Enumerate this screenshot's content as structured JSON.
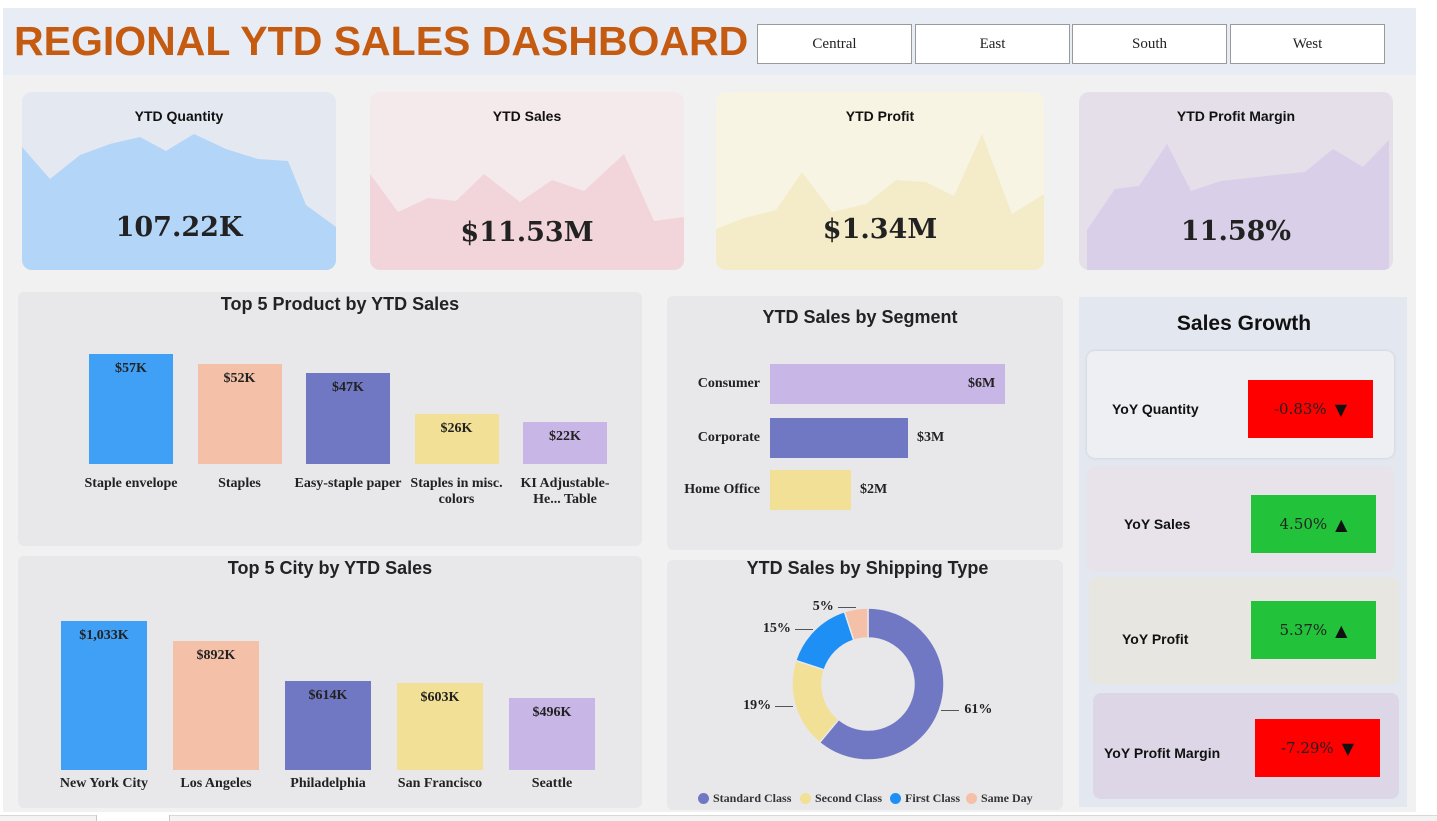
{
  "header": {
    "title": "REGIONAL YTD SALES DASHBOARD",
    "regions": [
      "Central",
      "East",
      "South",
      "West"
    ]
  },
  "kpis": [
    {
      "title": "YTD Quantity",
      "value": "107.22K",
      "bg": "#e4e8f1",
      "area": "#b3d5f7"
    },
    {
      "title": "YTD Sales",
      "value": "$11.53M",
      "bg": "#f4e9eb",
      "area": "#f2d5da"
    },
    {
      "title": "YTD Profit",
      "value": "$1.34M",
      "bg": "#f8f4e4",
      "area": "#f4ecc8"
    },
    {
      "title": "YTD Profit Margin",
      "value": "11.58%",
      "bg": "#e4dfe9",
      "area": "#d9cfe8"
    }
  ],
  "top_products": {
    "title": "Top 5 Product by YTD Sales",
    "items": [
      {
        "label": "Staple envelope",
        "value_label": "$57K",
        "value": 57,
        "color": "#3fa0f6"
      },
      {
        "label": "Staples",
        "value_label": "$52K",
        "value": 52,
        "color": "#f5c0a8"
      },
      {
        "label": "Easy-staple paper",
        "value_label": "$47K",
        "value": 47,
        "color": "#7078c4"
      },
      {
        "label": "Staples in misc. colors",
        "value_label": "$26K",
        "value": 26,
        "color": "#f1e095"
      },
      {
        "label": "KI Adjustable-He... Table",
        "value_label": "$22K",
        "value": 22,
        "color": "#c8b6e6"
      }
    ]
  },
  "top_cities": {
    "title": "Top 5 City by YTD Sales",
    "items": [
      {
        "label": "New York City",
        "value_label": "$1,033K",
        "value": 1033,
        "color": "#3fa0f6"
      },
      {
        "label": "Los Angeles",
        "value_label": "$892K",
        "value": 892,
        "color": "#f5c0a8"
      },
      {
        "label": "Philadelphia",
        "value_label": "$614K",
        "value": 614,
        "color": "#7078c4"
      },
      {
        "label": "San Francisco",
        "value_label": "$603K",
        "value": 603,
        "color": "#f1e095"
      },
      {
        "label": "Seattle",
        "value_label": "$496K",
        "value": 496,
        "color": "#c8b6e6"
      }
    ]
  },
  "segments": {
    "title": "YTD Sales by Segment",
    "items": [
      {
        "label": "Consumer",
        "value_label": "$6M",
        "value": 5.8,
        "color": "#c8b6e6"
      },
      {
        "label": "Corporate",
        "value_label": "$3M",
        "value": 3.4,
        "color": "#7078c4"
      },
      {
        "label": "Home Office",
        "value_label": "$2M",
        "value": 2.0,
        "color": "#f1e095"
      }
    ]
  },
  "shipping": {
    "title": "YTD Sales by Shipping Type",
    "items": [
      {
        "label": "Standard Class",
        "pct": 61,
        "pct_label": "61%",
        "color": "#7078c4"
      },
      {
        "label": "Second Class",
        "pct": 19,
        "pct_label": "19%",
        "color": "#f1e095"
      },
      {
        "label": "First Class",
        "pct": 15,
        "pct_label": "15%",
        "color": "#1e90f5"
      },
      {
        "label": "Same Day",
        "pct": 5,
        "pct_label": "5%",
        "color": "#f5c0a8"
      }
    ]
  },
  "growth": {
    "title": "Sales Growth",
    "items": [
      {
        "label": "YoY Quantity",
        "value": "-0.83%",
        "arrow": "▼",
        "color": "#ff0000",
        "card": "#eeeff3"
      },
      {
        "label": "YoY Sales",
        "value": "4.50%",
        "arrow": "▲",
        "color": "#22c33a",
        "card": "#e8e3ea"
      },
      {
        "label": "YoY Profit",
        "value": "5.37%",
        "arrow": "▲",
        "color": "#22c33a",
        "card": "#e8e6e1"
      },
      {
        "label": "YoY Profit Margin",
        "value": "-7.29%",
        "arrow": "▼",
        "color": "#ff0000",
        "card": "#dcd6e6"
      }
    ]
  }
}
